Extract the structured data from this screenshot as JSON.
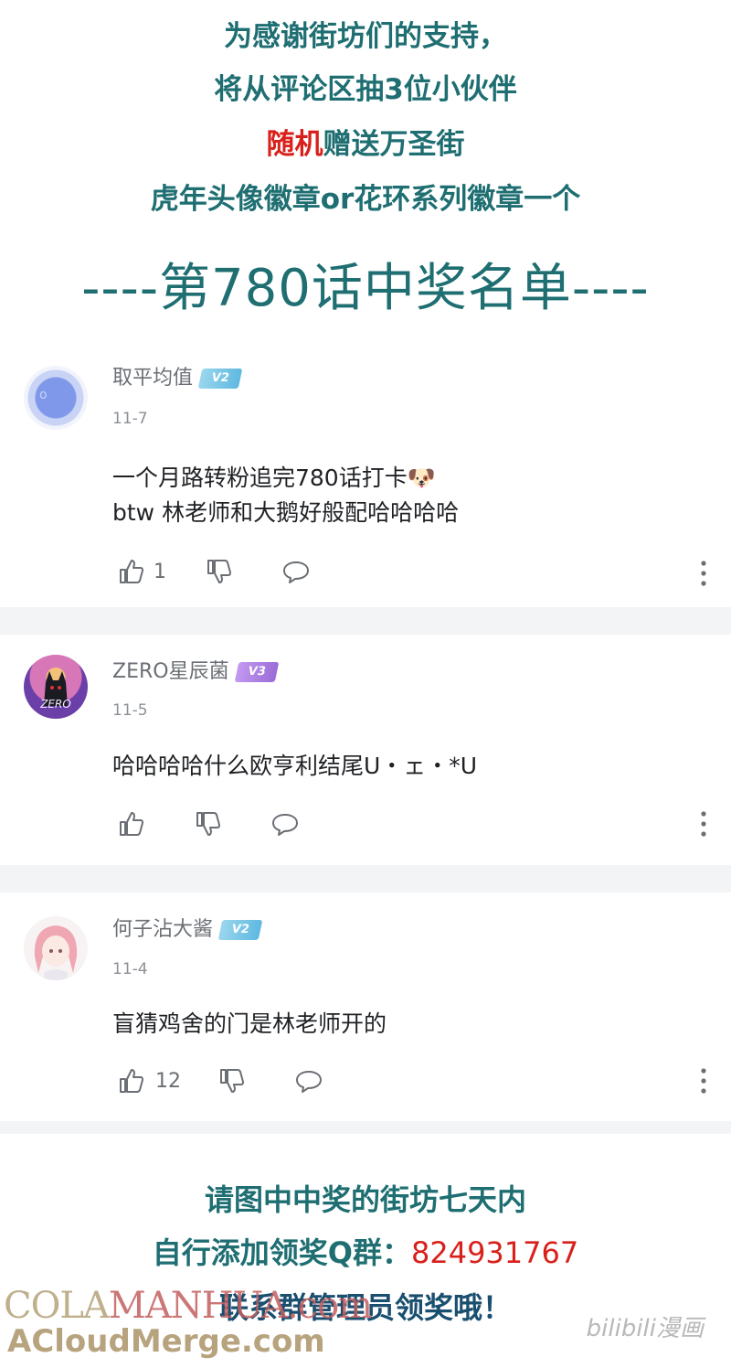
{
  "header": {
    "line1": "为感谢街坊们的支持，",
    "line2": "将从评论区抽3位小伙伴",
    "line3_red": "随机",
    "line3_rest": "赠送万圣街",
    "line4": "虎年头像徽章or花环系列徽章一个",
    "title": "----第780话中奖名单----"
  },
  "comments": [
    {
      "username": "取平均值",
      "level": "V2",
      "date": "11-7",
      "text_line1": "一个月路转粉追完780话打卡🐶",
      "text_line2": "btw 林老师和大鹅好般配哈哈哈哈",
      "likes": "1"
    },
    {
      "username": "ZERO星辰菌",
      "level": "V3",
      "date": "11-5",
      "text_line1": "哈哈哈哈什么欧亨利结尾U・ェ・*U",
      "likes": ""
    },
    {
      "username": "何子沾大酱",
      "level": "V2",
      "date": "11-4",
      "text_line1": "盲猜鸡舍的门是林老师开的",
      "likes": "12"
    }
  ],
  "footer": {
    "line1": "请图中中奖的街坊七天内",
    "line2_prefix": "自行添加领奖Q群：",
    "line2_number": "824931767",
    "line3": "联系群管理员领奖哦！"
  },
  "watermark": {
    "cola": "COLA",
    "manhua": "MANHUA",
    "dotcom": ".com",
    "acloud": "ACloudMerge.com",
    "bilibili": "bilibili漫画"
  },
  "colors": {
    "teal": "#1e6e72",
    "red": "#d9201a",
    "divider": "#f3f4f6"
  }
}
